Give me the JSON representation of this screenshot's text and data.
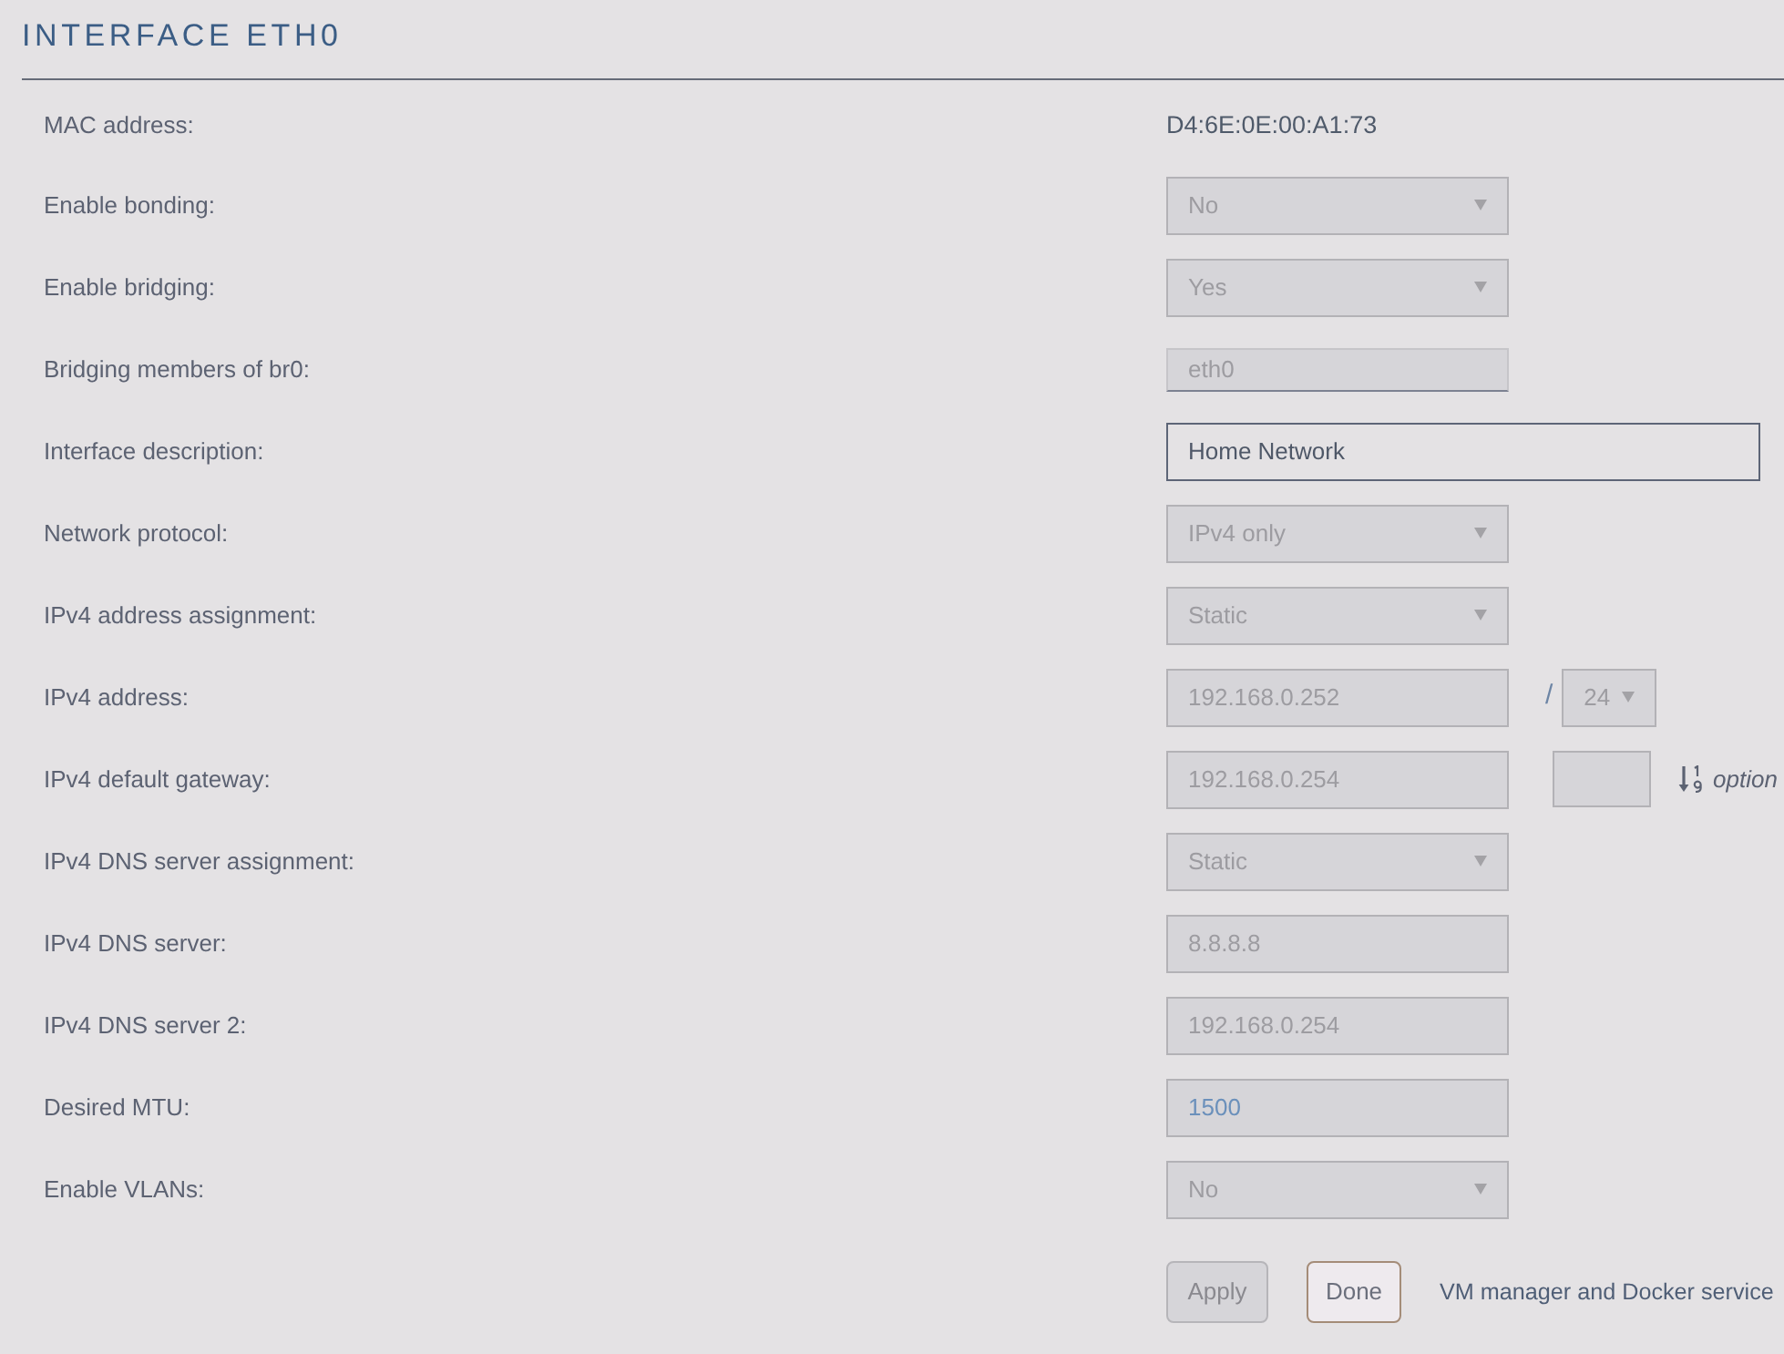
{
  "title": "INTERFACE ETH0",
  "rows": [
    {
      "label": "MAC address:",
      "kind": "text",
      "value": "D4:6E:0E:00:A1:73"
    },
    {
      "label": "Enable bonding:",
      "kind": "select",
      "value": "No",
      "disabled": true
    },
    {
      "label": "Enable bridging:",
      "kind": "select",
      "value": "Yes",
      "disabled": true
    },
    {
      "label": "Bridging members of br0:",
      "kind": "list-input",
      "value": "eth0",
      "disabled": true
    },
    {
      "label": "Interface description:",
      "kind": "input",
      "value": "Home Network",
      "disabled": false
    },
    {
      "label": "Network protocol:",
      "kind": "select",
      "value": "IPv4 only",
      "disabled": true
    },
    {
      "label": "IPv4 address assignment:",
      "kind": "select",
      "value": "Static",
      "disabled": true
    },
    {
      "label": "IPv4 address:",
      "kind": "input",
      "value": "192.168.0.252",
      "disabled": true,
      "suffix": {
        "kind": "netmask",
        "separator": "/",
        "value": "24",
        "disabled": true
      }
    },
    {
      "label": "IPv4 default gateway:",
      "kind": "input",
      "value": "192.168.0.254",
      "disabled": true,
      "suffix": {
        "kind": "metric",
        "disabled": true,
        "note": "option"
      }
    },
    {
      "label": "IPv4 DNS server assignment:",
      "kind": "select",
      "value": "Static",
      "disabled": true
    },
    {
      "label": "IPv4 DNS server:",
      "kind": "input",
      "value": "8.8.8.8",
      "disabled": true
    },
    {
      "label": "IPv4 DNS server 2:",
      "kind": "input",
      "value": "192.168.0.254",
      "disabled": true
    },
    {
      "label": "Desired MTU:",
      "kind": "number",
      "value": "1500",
      "disabled": true
    },
    {
      "label": "Enable VLANs:",
      "kind": "select",
      "value": "No",
      "disabled": true
    }
  ],
  "buttons": [
    {
      "label": "Apply",
      "disabled": true
    },
    {
      "label": "Done",
      "disabled": false
    }
  ],
  "note": "VM manager and Docker service"
}
